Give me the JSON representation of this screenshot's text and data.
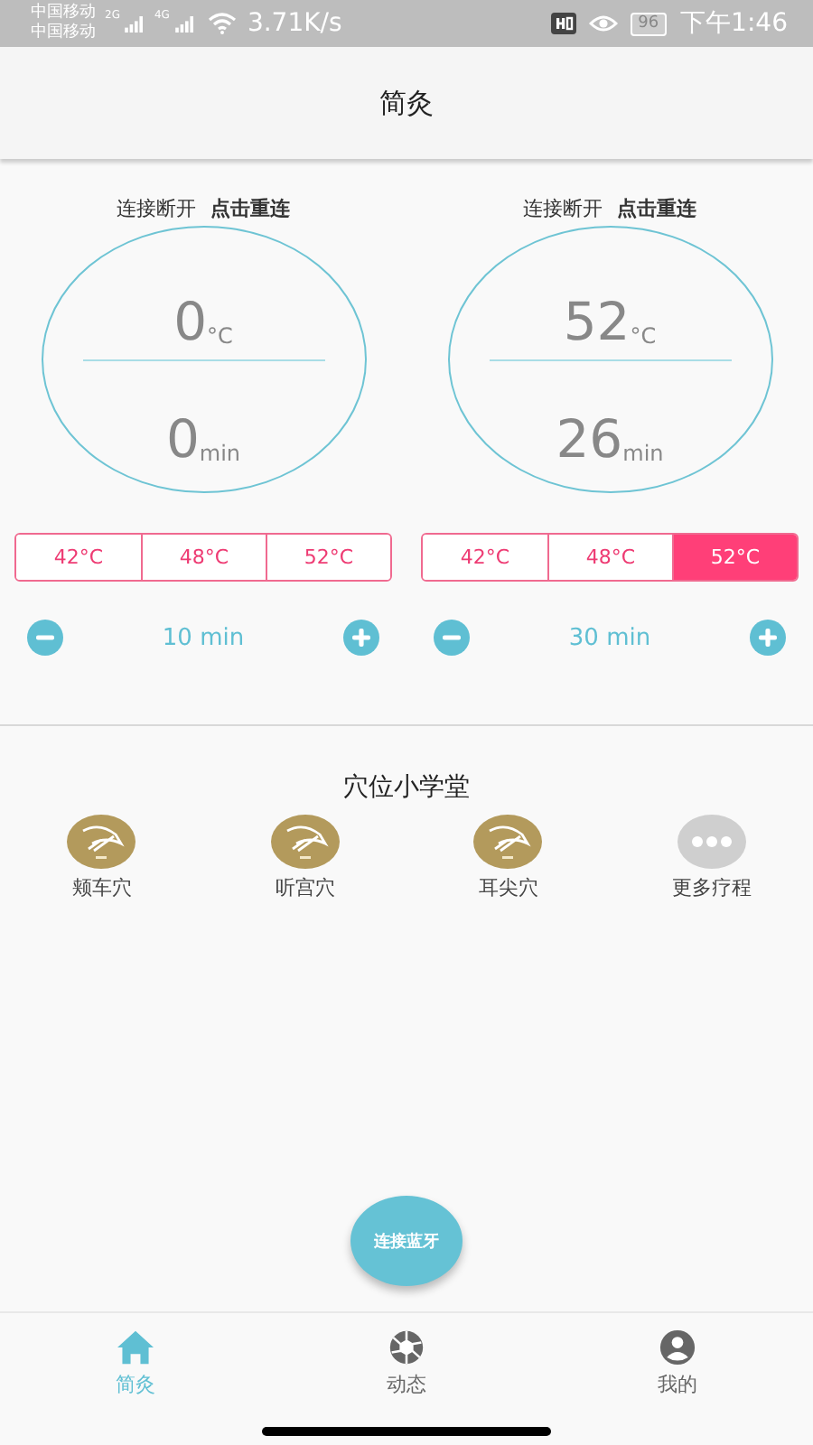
{
  "status_bar": {
    "carriers": [
      "中国移动",
      "中国移动"
    ],
    "networks": [
      "2G",
      "4G"
    ],
    "speed": "3.71K/s",
    "battery": "96",
    "time": "下午1:46"
  },
  "title": "简灸",
  "devices": [
    {
      "status": "连接断开",
      "action": "点击重连",
      "temperature": "0",
      "temp_unit": "°C",
      "time": "0",
      "time_unit": "min",
      "presets": [
        {
          "label": "42°C",
          "selected": false
        },
        {
          "label": "48°C",
          "selected": false
        },
        {
          "label": "52°C",
          "selected": false
        }
      ],
      "duration": "10 min"
    },
    {
      "status": "连接断开",
      "action": "点击重连",
      "temperature": "52",
      "temp_unit": "°C",
      "time": "26",
      "time_unit": "min",
      "presets": [
        {
          "label": "42°C",
          "selected": false
        },
        {
          "label": "48°C",
          "selected": false
        },
        {
          "label": "52°C",
          "selected": true
        }
      ],
      "duration": "30 min"
    }
  ],
  "section": {
    "title": "穴位小学堂",
    "items": [
      {
        "label": "颊车穴",
        "kind": "acupoint"
      },
      {
        "label": "听宫穴",
        "kind": "acupoint"
      },
      {
        "label": "耳尖穴",
        "kind": "acupoint"
      },
      {
        "label": "更多疗程",
        "kind": "more"
      }
    ]
  },
  "fab": "连接蓝牙",
  "nav": [
    {
      "label": "简灸",
      "kind": "home",
      "selected": true
    },
    {
      "label": "动态",
      "kind": "shutter",
      "selected": false
    },
    {
      "label": "我的",
      "kind": "person",
      "selected": false
    }
  ]
}
